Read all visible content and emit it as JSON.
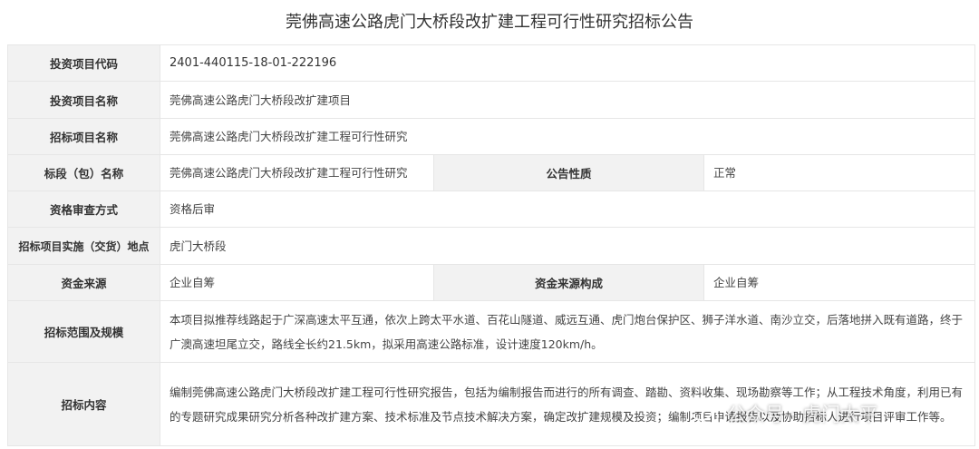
{
  "title": "莞佛高速公路虎门大桥段改扩建工程可行性研究招标公告",
  "rows": {
    "project_code": {
      "label": "投资项目代码",
      "value": "2401-440115-18-01-222196"
    },
    "project_name": {
      "label": "投资项目名称",
      "value": "莞佛高速公路虎门大桥段改扩建项目"
    },
    "tender_name": {
      "label": "招标项目名称",
      "value": "莞佛高速公路虎门大桥段改扩建工程可行性研究"
    },
    "section": {
      "label": "标段（包）名称",
      "value": "莞佛高速公路虎门大桥段改扩建工程可行性研究",
      "label2": "公告性质",
      "value2": "正常"
    },
    "qualification": {
      "label": "资格审查方式",
      "value": "资格后审"
    },
    "location": {
      "label": "招标项目实施（交货）地点",
      "value": "虎门大桥段"
    },
    "funding": {
      "label": "资金来源",
      "value": "企业自筹",
      "label2": "资金来源构成",
      "value2": "企业自筹"
    },
    "scope": {
      "label": "招标范围及规模",
      "value": "本项目拟推荐线路起于广深高速太平互通，依次上跨太平水道、百花山隧道、威远互通、虎门炮台保护区、狮子洋水道、南沙立交，后落地拼入既有道路，终于广澳高速坦尾立交，路线全长约21.5km，拟采用高速公路标准，设计速度120km/h。"
    },
    "content": {
      "label": "招标内容",
      "value": "编制莞佛高速公路虎门大桥段改扩建工程可行性研究报告，包括为编制报告而进行的所有调查、踏勘、资料收集、现场勘察等工作；从工程技术角度，利用已有的专题研究成果研究分析各种改扩建方案、技术标准及节点技术解决方案，确定改扩建规模及投资；编制项目申请报告以及协助招标人进行项目评审工作等。"
    }
  },
  "watermark": {
    "text": "公众号 · 虎门太平",
    "icon": "wechat-icon"
  }
}
